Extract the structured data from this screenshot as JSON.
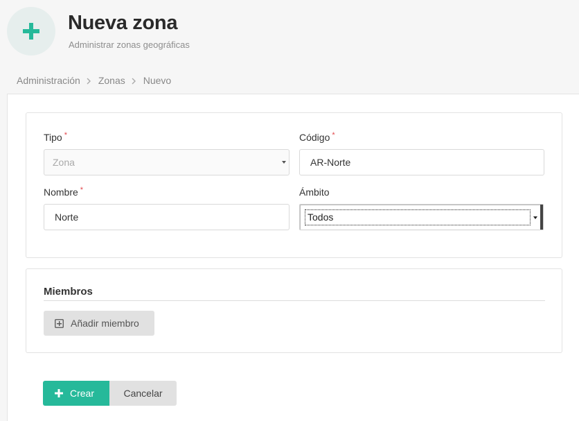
{
  "header": {
    "icon": "plus-icon",
    "title": "Nueva zona",
    "subtitle": "Administrar zonas geográficas"
  },
  "breadcrumb": {
    "items": [
      "Administración",
      "Zonas",
      "Nuevo"
    ],
    "separator_icon": "chevron-right-icon"
  },
  "form": {
    "tipo": {
      "label": "Tipo",
      "required": "*",
      "value": "Zona",
      "disabled": true
    },
    "codigo": {
      "label": "Código",
      "required": "*",
      "value": "AR-Norte"
    },
    "nombre": {
      "label": "Nombre",
      "required": "*",
      "value": "Norte"
    },
    "ambito": {
      "label": "Ámbito",
      "value": "Todos"
    }
  },
  "members": {
    "title": "Miembros",
    "add_button": {
      "icon": "plus-square-icon",
      "label": "Añadir miembro"
    }
  },
  "actions": {
    "create": {
      "icon": "plus-icon",
      "label": "Crear"
    },
    "cancel": {
      "label": "Cancelar"
    }
  },
  "colors": {
    "accent": "#26b99a",
    "required": "#e2474b",
    "button_gray": "#e1e1e1"
  }
}
